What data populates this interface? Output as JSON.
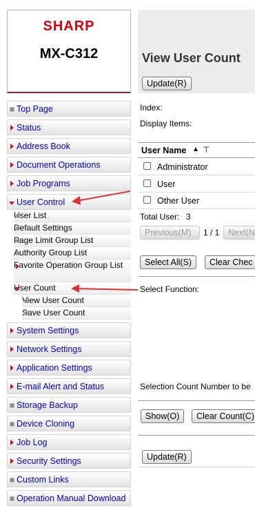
{
  "sidebar": {
    "brand": "SHARP",
    "model": "MX-C312",
    "items": [
      {
        "label": "Top Page"
      },
      {
        "label": "Status"
      },
      {
        "label": "Address Book"
      },
      {
        "label": "Document Operations"
      },
      {
        "label": "Job Programs"
      },
      {
        "label": "User Control"
      },
      {
        "label": "User List"
      },
      {
        "label": "Default Settings"
      },
      {
        "label": "Page Limit Group List"
      },
      {
        "label": "Authority Group List"
      },
      {
        "label": "Favorite Operation Group List"
      },
      {
        "label": "User Count"
      },
      {
        "label": "View User Count"
      },
      {
        "label": "Save User Count"
      },
      {
        "label": "System Settings"
      },
      {
        "label": "Network Settings"
      },
      {
        "label": "Application Settings"
      },
      {
        "label": "E-mail Alert and Status"
      },
      {
        "label": "Storage Backup"
      },
      {
        "label": "Device Cloning"
      },
      {
        "label": "Job Log"
      },
      {
        "label": "Security Settings"
      },
      {
        "label": "Custom Links"
      },
      {
        "label": "Operation Manual Download"
      }
    ]
  },
  "main": {
    "title": "View User Count",
    "update_label": "Update(R)",
    "index_label": "Index:",
    "display_items_label": "Display Items:",
    "column_header": "User Name",
    "users": [
      "Administrator",
      "User",
      "Other User"
    ],
    "total_label": "Total User:",
    "total_value": "3",
    "prev_label": "Previous(M)",
    "page_indicator": "1 / 1",
    "next_label": "Next(N",
    "select_all_label": "Select All(S)",
    "clear_check_label": "Clear Chec",
    "select_function_label": "Select Function:",
    "selection_count_label": "Selection Count Number to be",
    "show_label": "Show(O)",
    "clear_count_label": "Clear Count(C)",
    "update_bottom_label": "Update(R)"
  },
  "colors": {
    "brand_red": "#d8000f",
    "link_blue": "#0000cc",
    "annotation_arrow": "#e03030"
  }
}
